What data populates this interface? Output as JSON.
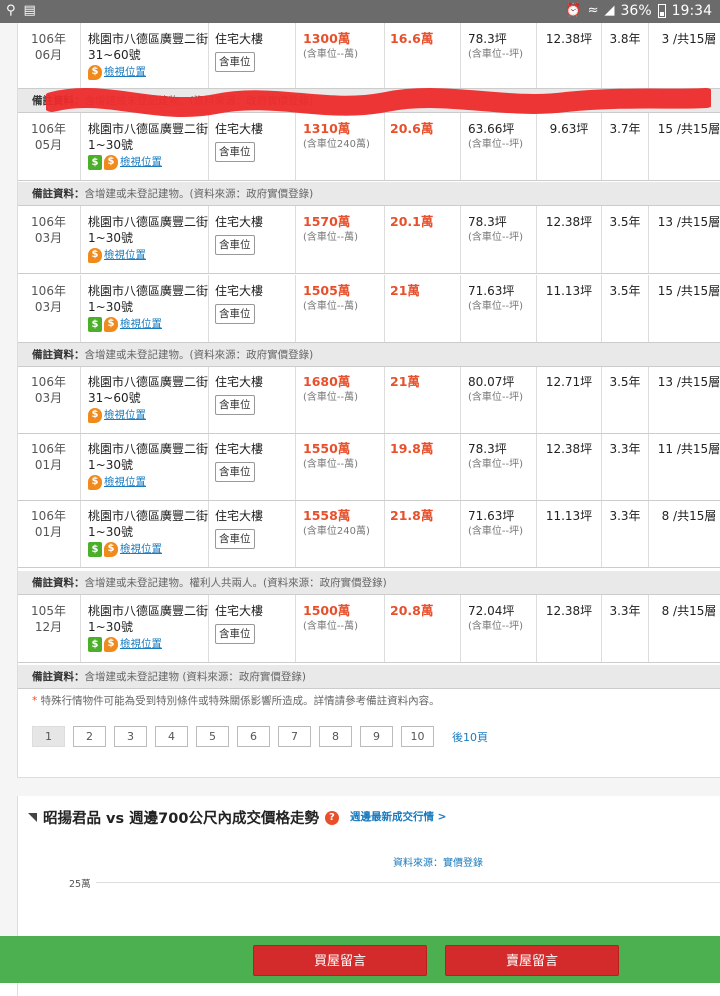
{
  "status": {
    "battery": "36%",
    "time": "19:34"
  },
  "rows": [
    {
      "date": "106年\n06月",
      "addr": "桃園市八德區廣豐二街31~60號",
      "icons": [
        "pin"
      ],
      "map": "檢視位置",
      "type": "住宅大樓",
      "parking": "含車位",
      "price": "1300萬",
      "price_sub": "(含車位--萬)",
      "unit": "16.6萬",
      "area": "78.3坪",
      "area_sub": "(含車位--坪)",
      "land": "12.38坪",
      "age": "3.8年",
      "floor": "3 /共15層"
    },
    {
      "date": "106年\n05月",
      "addr": "桃園市八德區廣豐二街1~30號",
      "icons": [
        "dollar",
        "pin"
      ],
      "map": "檢視位置",
      "type": "住宅大樓",
      "parking": "含車位",
      "price": "1310萬",
      "price_sub": "(含車位240萬)",
      "unit": "20.6萬",
      "area": "63.66坪",
      "area_sub": "(含車位--坪)",
      "land": "9.63坪",
      "age": "3.7年",
      "floor": "15 /共15層"
    },
    {
      "date": "106年\n03月",
      "addr": "桃園市八德區廣豐二街1~30號",
      "icons": [
        "pin"
      ],
      "map": "檢視位置",
      "type": "住宅大樓",
      "parking": "含車位",
      "price": "1570萬",
      "price_sub": "(含車位--萬)",
      "unit": "20.1萬",
      "area": "78.3坪",
      "area_sub": "(含車位--坪)",
      "land": "12.38坪",
      "age": "3.5年",
      "floor": "13 /共15層"
    },
    {
      "date": "106年\n03月",
      "addr": "桃園市八德區廣豐二街1~30號",
      "icons": [
        "dollar",
        "pin"
      ],
      "map": "檢視位置",
      "type": "住宅大樓",
      "parking": "含車位",
      "price": "1505萬",
      "price_sub": "(含車位--萬)",
      "unit": "21萬",
      "area": "71.63坪",
      "area_sub": "(含車位--坪)",
      "land": "11.13坪",
      "age": "3.5年",
      "floor": "15 /共15層"
    },
    {
      "date": "106年\n03月",
      "addr": "桃園市八德區廣豐二街31~60號",
      "icons": [
        "pin"
      ],
      "map": "檢視位置",
      "type": "住宅大樓",
      "parking": "含車位",
      "price": "1680萬",
      "price_sub": "(含車位--萬)",
      "unit": "21萬",
      "area": "80.07坪",
      "area_sub": "(含車位--坪)",
      "land": "12.71坪",
      "age": "3.5年",
      "floor": "13 /共15層"
    },
    {
      "date": "106年\n01月",
      "addr": "桃園市八德區廣豐二街1~30號",
      "icons": [
        "pin"
      ],
      "map": "檢視位置",
      "type": "住宅大樓",
      "parking": "含車位",
      "price": "1550萬",
      "price_sub": "(含車位--萬)",
      "unit": "19.8萬",
      "area": "78.3坪",
      "area_sub": "(含車位--坪)",
      "land": "12.38坪",
      "age": "3.3年",
      "floor": "11 /共15層"
    },
    {
      "date": "106年\n01月",
      "addr": "桃園市八德區廣豐二街1~30號",
      "icons": [
        "dollar",
        "pin"
      ],
      "map": "檢視位置",
      "type": "住宅大樓",
      "parking": "含車位",
      "price": "1558萬",
      "price_sub": "(含車位240萬)",
      "unit": "21.8萬",
      "area": "71.63坪",
      "area_sub": "(含車位--坪)",
      "land": "11.13坪",
      "age": "3.3年",
      "floor": "8 /共15層"
    },
    {
      "date": "105年\n12月",
      "addr": "桃園市八德區廣豐二街1~30號",
      "icons": [
        "dollar",
        "pin"
      ],
      "map": "檢視位置",
      "type": "住宅大樓",
      "parking": "含車位",
      "price": "1500萬",
      "price_sub": "(含車位--萬)",
      "unit": "20.8萬",
      "area": "72.04坪",
      "area_sub": "(含車位--坪)",
      "land": "12.38坪",
      "age": "3.3年",
      "floor": "8 /共15層"
    }
  ],
  "notes": {
    "label": "備註資料：",
    "n1": "含增建或未登記建物。(資料來源：政府實價登錄)",
    "n1_hidden": "含增建或未登記建物。(資料來源：政府實價登錄)",
    "n2": "含增建或未登記建物。(資料來源：政府實價登錄)",
    "n3": "含增建或未登記建物。權利人共兩人。(資料來源：政府實價登錄)",
    "n4": "含增建或未登記建物 (資料來源：政府實價登錄)"
  },
  "footnote": "特殊行情物件可能為受到特別條件或特殊關係影響所造成。詳情請參考備註資料內容。",
  "pager": {
    "pages": [
      "1",
      "2",
      "3",
      "4",
      "5",
      "6",
      "7",
      "8",
      "9",
      "10"
    ],
    "next": "後10頁"
  },
  "trend": {
    "title": "昭揚君品 vs 週邊700公尺內成交價格走勢",
    "link": "週邊最新成交行情 >",
    "source": "資料來源：實價登錄",
    "ytick": "25萬"
  },
  "buttons": {
    "buy": "買屋留言",
    "sell": "賣屋留言"
  }
}
